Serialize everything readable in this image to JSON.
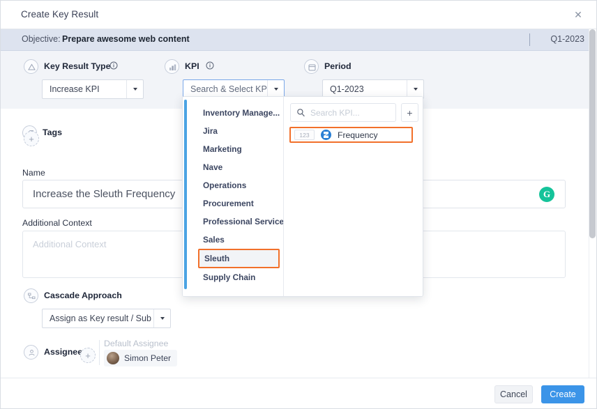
{
  "dialog": {
    "title": "Create Key Result",
    "close_icon": "close-icon"
  },
  "objective": {
    "label": "Objective:",
    "value": "Prepare awesome web content",
    "period": "Q1-2023"
  },
  "fields": {
    "key_result_type": {
      "label": "Key Result Type",
      "value": "Increase KPI",
      "icon": "triangle-target-icon",
      "info_icon": "info-icon"
    },
    "kpi": {
      "label": "KPI",
      "placeholder": "Search & Select KPI",
      "icon": "kpi-chart-icon",
      "info_icon": "info-icon"
    },
    "period": {
      "label": "Period",
      "value": "Q1-2023",
      "icon": "calendar-icon"
    },
    "tags": {
      "label": "Tags",
      "icon": "tag-icon",
      "add_label": "+"
    },
    "name": {
      "label": "Name",
      "value": "Increase the Sleuth Frequency",
      "assistant_icon": "grammarly-icon",
      "assistant_letter": "G"
    },
    "additional_context": {
      "label": "Additional Context",
      "placeholder": "Additional Context"
    },
    "cascade_approach": {
      "label": "Cascade Approach",
      "value": "Assign as Key result / Sub K...",
      "icon": "cascade-icon"
    },
    "assignee": {
      "label": "Assignee",
      "add_label": "+",
      "icon": "person-icon",
      "default_label": "Default Assignee",
      "default_name": "Simon Peter"
    }
  },
  "kpi_dropdown": {
    "categories": [
      "Inventory Manage...",
      "Jira",
      "Marketing",
      "Nave",
      "Operations",
      "Procurement",
      "Professional Services",
      "Sales",
      "Sleuth",
      "Supply Chain"
    ],
    "selected_category": "Sleuth",
    "search_placeholder": "Search KPI...",
    "search_icon": "search-icon",
    "add_button": "+",
    "results": [
      {
        "badge": "123",
        "logo": "jira-icon",
        "name": "Frequency"
      }
    ],
    "highlight_color": "#f2702a"
  },
  "footer": {
    "cancel": "Cancel",
    "create": "Create"
  }
}
